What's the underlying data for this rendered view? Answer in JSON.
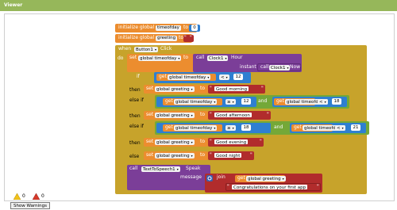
{
  "window": {
    "title": "Viewer"
  },
  "globals": [
    {
      "kw": "initialize global",
      "name": "timeofday",
      "to": "to",
      "value": "0"
    },
    {
      "kw": "initialize global",
      "name": "greeting",
      "to": "to",
      "open_quote": "\"",
      "close_quote": "\""
    }
  ],
  "event": {
    "when": "when",
    "component": "Button1",
    "event": "Click",
    "do": "do",
    "set_kw": "set",
    "set_var": "global timeofday",
    "set_to": "to",
    "call_kw": "call",
    "clock_comp": "Clock1",
    "clock_method": "Hour",
    "instant_label": "instant",
    "clock_comp2": "Clock1",
    "clock_now": "Now"
  },
  "ifblock": {
    "if_kw": "if",
    "then_kw": "then",
    "elseif_kw": "else if",
    "else_kw": "else",
    "get_kw": "get",
    "var_tod": "global timeofday",
    "var_greet": "global greeting",
    "lt": "<",
    "ge": "≥",
    "and_kw": "and",
    "set_kw": "set",
    "to_kw": "to",
    "c1": {
      "op": "<",
      "val": "12"
    },
    "s1": "Good morning",
    "c2a": {
      "op": "≥",
      "val": "12"
    },
    "c2b": {
      "op": "<",
      "val": "18"
    },
    "s2": "Good afternoon",
    "c3a": {
      "op": "≥",
      "val": "18"
    },
    "c3b": {
      "op": "<",
      "val": "21"
    },
    "s3": "Good evening",
    "s4": "Good night"
  },
  "speak": {
    "call_kw": "call",
    "component": "TextToSpeech1",
    "method": "Speak",
    "message_label": "message",
    "join_kw": "join",
    "get_kw": "get",
    "var": "global greeting",
    "text": "Congratulations on your first app",
    "quote": "\""
  },
  "warnings": {
    "warn_count": "0",
    "error_count": "0",
    "button": "Show Warnings"
  },
  "colors": {
    "variables": "#ec8d2f",
    "control": "#c7a32b",
    "math": "#2f7fd1",
    "logic": "#74a838",
    "text": "#b12c2c",
    "components": "#7b3e98"
  },
  "icons": [
    "gear-icon",
    "warning-icon",
    "error-icon"
  ]
}
